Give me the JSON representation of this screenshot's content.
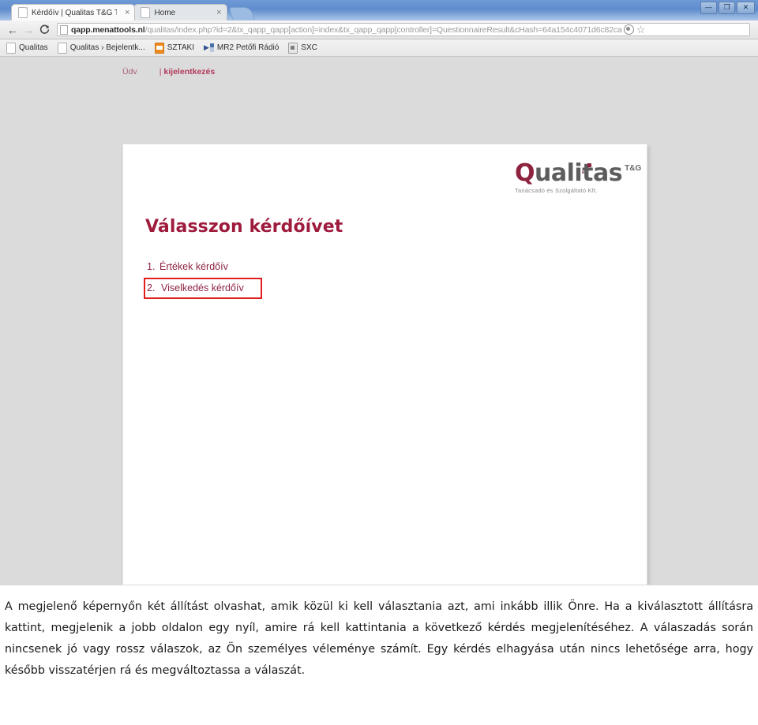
{
  "browser": {
    "tabs": [
      {
        "title": "Kérdőív | Qualitas T&G T",
        "close": "×",
        "active": true
      },
      {
        "title": "Home",
        "close": "×",
        "active": false
      }
    ],
    "window_controls": {
      "minimize": "—",
      "maximize": "❐",
      "close": "✕"
    },
    "nav": {
      "back": "←",
      "forward": "→",
      "reload": "C",
      "star": "☆"
    },
    "omnibox": {
      "host": "qapp.menattools.nl",
      "path": "/qualitas/index.php?id=2&tx_qapp_qapp[action]=index&tx_qapp_qapp[controller]=QuestionnaireResult&cHash=64a154c4071d6c82ca"
    },
    "bookmarks": [
      {
        "label": "Qualitas",
        "icon": "page-icon"
      },
      {
        "label": "Qualitas › Bejelentk...",
        "icon": "page-icon"
      },
      {
        "label": "SZTAKI",
        "icon": "sztaki-icon"
      },
      {
        "label": "MR2 Petőfi Rádió",
        "icon": "radio-icon"
      },
      {
        "label": "SXC",
        "icon": "sxc-icon"
      }
    ]
  },
  "page": {
    "header": {
      "greeting": "Üdv",
      "separator": "|",
      "logout": "kijelentkezés"
    },
    "logo": {
      "brand_first": "Q",
      "brand_rest": "ualitas",
      "superscript": "T&G",
      "tagline": "Tanácsadó és Szolgáltató Kft."
    },
    "title": "Válasszon kérdőívet",
    "questionnaires": [
      {
        "number": "1.",
        "label": "Értékek kérdőív",
        "highlighted": false
      },
      {
        "number": "2.",
        "label": "Viselkedés kérdőív",
        "highlighted": true
      }
    ]
  },
  "caption": {
    "paragraph": "A megjelenő képernyőn két állítást olvashat, amik közül ki kell választania azt, ami inkább illik Önre. Ha a kiválasztott állításra kattint, megjelenik a jobb oldalon egy nyíl, amire rá kell kattintania a következő kérdés megjelenítéséhez. A válaszadás során nincsenek jó vagy rossz válaszok, az Ön személyes véleménye számít. Egy kérdés elhagyása után nincs lehetősége arra, hogy később visszatérjen rá és megváltoztassa a válaszát."
  },
  "colors": {
    "brand_maroon": "#8e2340",
    "title_red": "#9e1b3c",
    "highlight_red": "#e01e1e",
    "chrome_blue": "#7ba2d9",
    "page_bg": "#dbdbdb"
  }
}
